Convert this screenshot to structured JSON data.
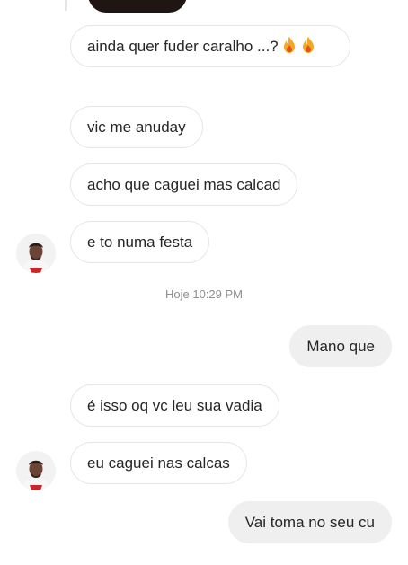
{
  "messages": [
    {
      "text": "ainda quer fuder caralho ...?",
      "emoji": "fire-icon"
    },
    {
      "text": "vic me anuday"
    },
    {
      "text": "acho que caguei mas calcad"
    },
    {
      "text": "e to numa festa"
    },
    {
      "text": "Mano que"
    },
    {
      "text": "é isso oq vc leu sua vadia"
    },
    {
      "text": "eu caguei nas calcas"
    },
    {
      "text": "Vai toma no seu cu"
    }
  ],
  "timestamp": "Hoje 10:29 PM",
  "colors": {
    "incoming_bg": "#ffffff",
    "incoming_border": "#e6e6e6",
    "outgoing_bg": "#efefef",
    "text": "#262626",
    "timestamp": "#8e8e8e",
    "flame_outer": "#f5a623",
    "flame_inner": "#e8521a"
  }
}
